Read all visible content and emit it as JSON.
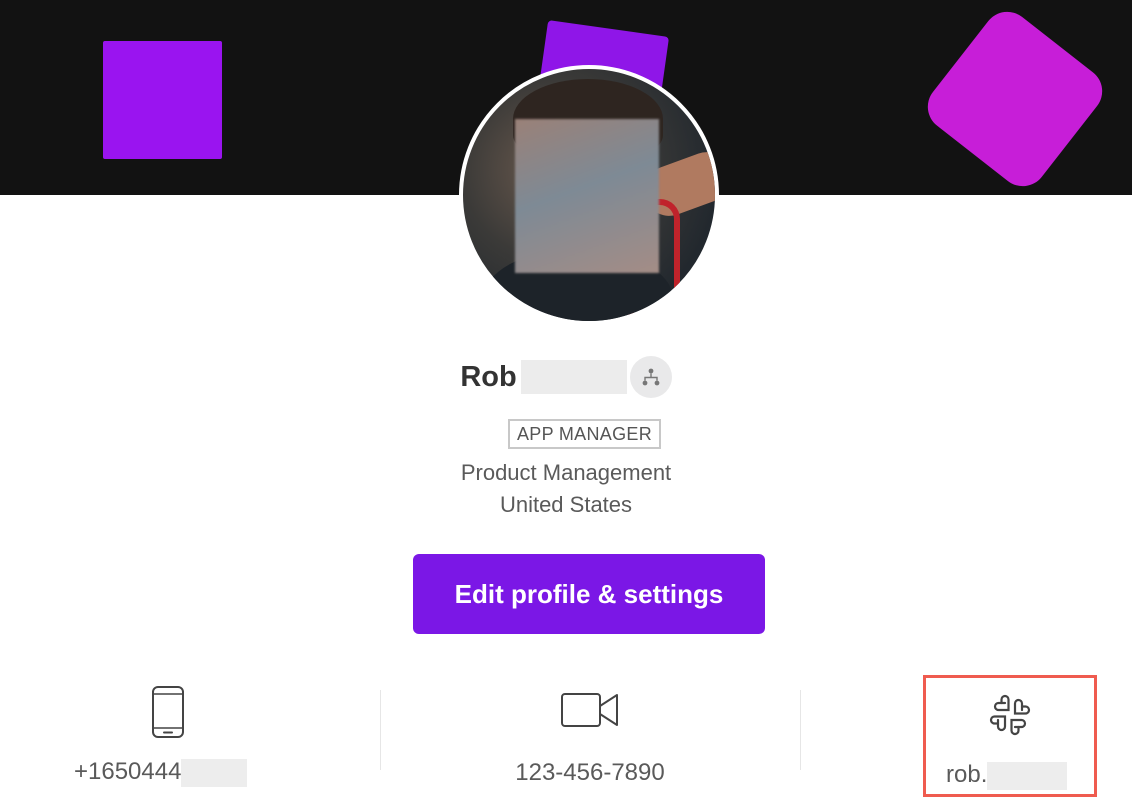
{
  "profile": {
    "first_name": "Rob",
    "role": "APP MANAGER",
    "department": "Product Management",
    "location": "United States"
  },
  "actions": {
    "edit_label": "Edit profile & settings"
  },
  "contacts": {
    "phone": "+1650444",
    "video": "123-456-7890",
    "slack": "rob."
  },
  "colors": {
    "banner": "#121212",
    "accent": "#7b17e6",
    "highlight": "#ef5b4f"
  },
  "icons": [
    "org-chart-icon",
    "mobile-phone-icon",
    "video-camera-icon",
    "slack-icon"
  ]
}
